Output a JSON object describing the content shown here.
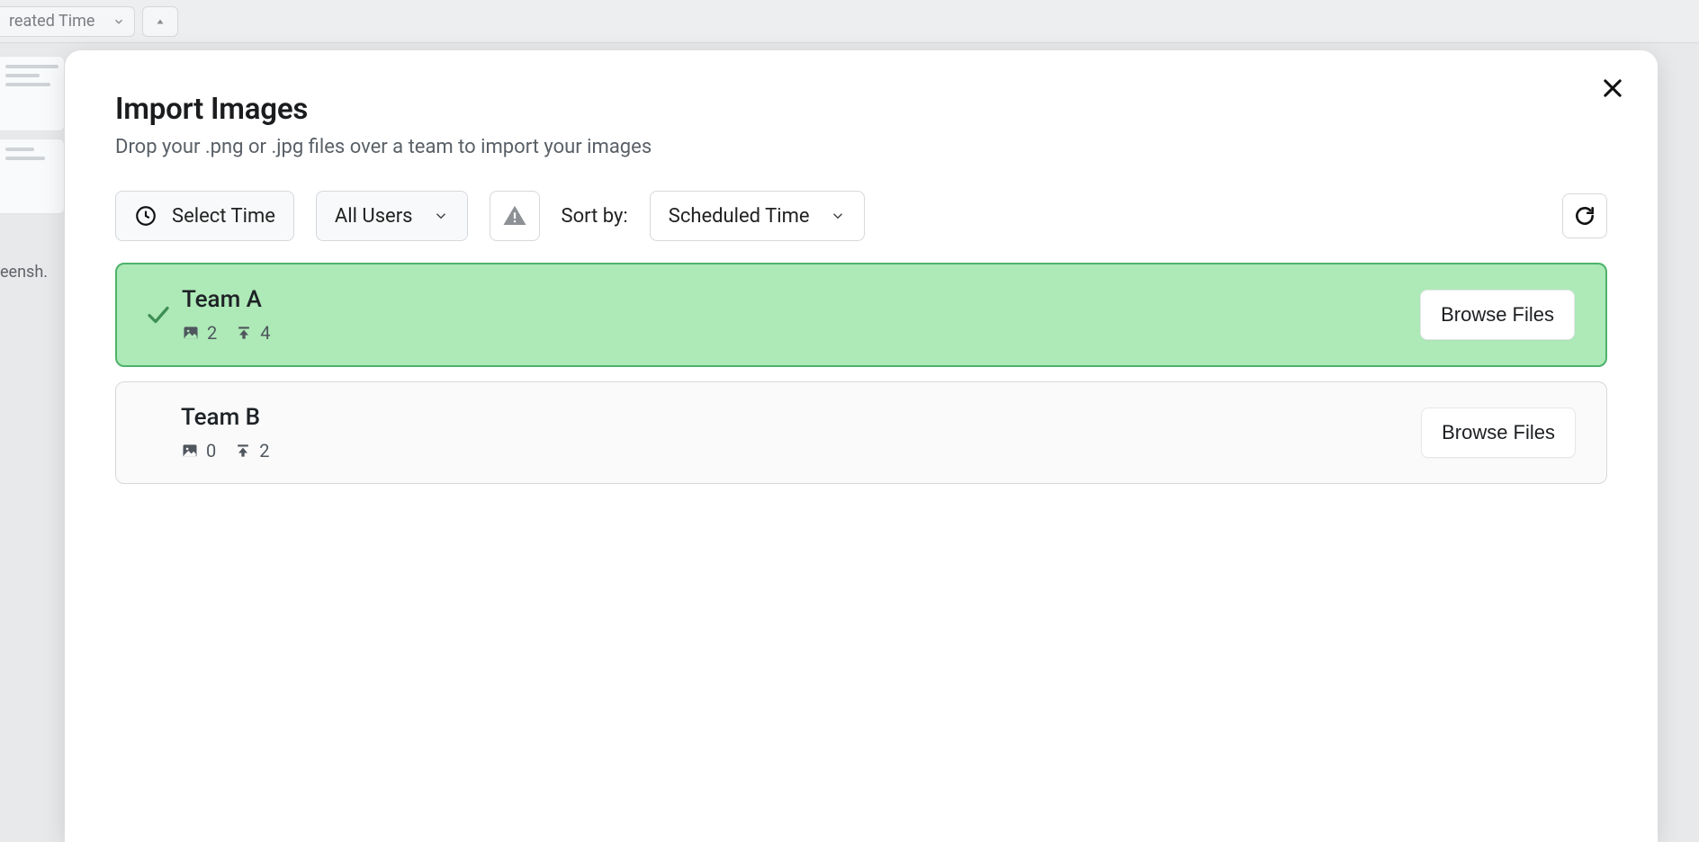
{
  "background": {
    "dropdown_label": "reated Time",
    "left_partial_text": "eensh."
  },
  "modal": {
    "title": "Import Images",
    "subtitle": "Drop your .png or .jpg files over a team to import your images",
    "toolbar": {
      "select_time_label": "Select Time",
      "users_filter_label": "All Users",
      "sort_by_label": "Sort by:",
      "sort_value": "Scheduled Time"
    },
    "teams": [
      {
        "name": "Team A",
        "selected": true,
        "image_count": "2",
        "upload_count": "4",
        "browse_label": "Browse Files"
      },
      {
        "name": "Team B",
        "selected": false,
        "image_count": "0",
        "upload_count": "2",
        "browse_label": "Browse Files"
      }
    ]
  }
}
